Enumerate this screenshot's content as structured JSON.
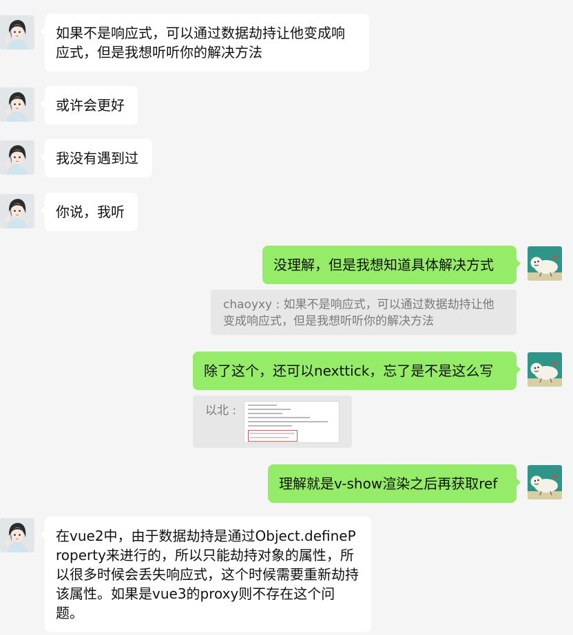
{
  "messages": [
    {
      "side": "left",
      "avatar": "girl-avatar-icon",
      "text": "如果不是响应式，可以通过数据劫持让他变成响应式，但是我想听听你的解决方法"
    },
    {
      "side": "left",
      "avatar": "girl-avatar-icon",
      "text": "或许会更好"
    },
    {
      "side": "left",
      "avatar": "girl-avatar-icon",
      "text": "我没有遇到过"
    },
    {
      "side": "left",
      "avatar": "girl-avatar-icon",
      "text": "你说，我听"
    },
    {
      "side": "right",
      "avatar": "cartoon-avatar-icon",
      "text": "没理解，但是我想知道具体解决方式"
    },
    {
      "type": "quote",
      "author": "chaoyxy",
      "text": "chaoyxy : 如果不是响应式，可以通过数据劫持让他变成响应式，但是我想听听你的解决方法"
    },
    {
      "side": "right",
      "avatar": "cartoon-avatar-icon",
      "text": "除了这个，还可以nexttick，忘了是不是这么写"
    },
    {
      "type": "quote-image",
      "author": "以北",
      "text": "以北 :"
    },
    {
      "side": "right",
      "avatar": "cartoon-avatar-icon",
      "text": "理解就是v-show渲染之后再获取ref"
    },
    {
      "side": "left",
      "avatar": "girl-avatar-icon",
      "text": "在vue2中，由于数据劫持是通过Object.defineProperty来进行的，所以只能劫持对象的属性，所以很多时候会丢失响应式，这个时候需要重新劫持该属性。如果是vue3的proxy则不存在这个问题。"
    }
  ],
  "colors": {
    "background": "#f5f5f5",
    "bubble_self": "#95ec69",
    "bubble_other": "#ffffff",
    "quote": "#e7e7e7"
  }
}
